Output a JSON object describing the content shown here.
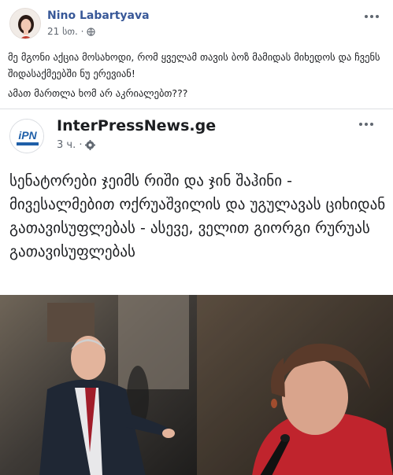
{
  "post": {
    "author": "Nino Labartyava",
    "time": "21 სთ. ·",
    "text_lines": [
      "მე მგონი აქცია მოსახოდი, რომ ყველამ თავის ბოზ მამიდას მიხედოს და ჩვენს შიდასაქმეებში ნუ ერევიან!",
      "ამათ მართლა ხომ არ აკრიალებთ???"
    ]
  },
  "shared": {
    "page_name": "InterPressNews.ge",
    "logo_text": "iPN",
    "time": "3 ч. ·",
    "headline": "სენატორები ჯეიმს რიში და ჯინ შაჰინი - მივესალმებით ოქრუაშვილის და უგულავას ციხიდან გათავისუფლებას - ასევე, ველით გიორგი რურუას გათავისუფლებას"
  },
  "icons": {
    "privacy": "globe-icon",
    "settings_public": "gear-public-icon",
    "more": "more-options-icon"
  },
  "colors": {
    "author_link": "#385898",
    "meta_gray": "#606770",
    "logo_blue": "#1f5fa8"
  }
}
